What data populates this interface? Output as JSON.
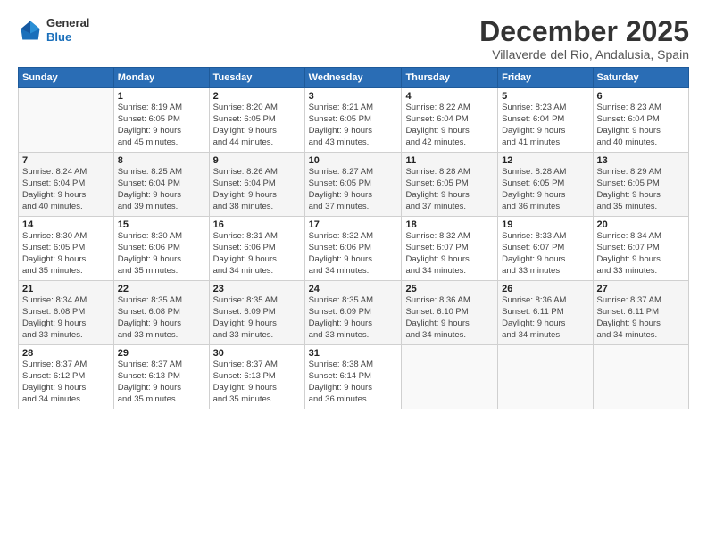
{
  "logo": {
    "general": "General",
    "blue": "Blue"
  },
  "title": "December 2025",
  "subtitle": "Villaverde del Rio, Andalusia, Spain",
  "weekdays": [
    "Sunday",
    "Monday",
    "Tuesday",
    "Wednesday",
    "Thursday",
    "Friday",
    "Saturday"
  ],
  "weeks": [
    [
      {
        "day": "",
        "info": ""
      },
      {
        "day": "1",
        "info": "Sunrise: 8:19 AM\nSunset: 6:05 PM\nDaylight: 9 hours\nand 45 minutes."
      },
      {
        "day": "2",
        "info": "Sunrise: 8:20 AM\nSunset: 6:05 PM\nDaylight: 9 hours\nand 44 minutes."
      },
      {
        "day": "3",
        "info": "Sunrise: 8:21 AM\nSunset: 6:05 PM\nDaylight: 9 hours\nand 43 minutes."
      },
      {
        "day": "4",
        "info": "Sunrise: 8:22 AM\nSunset: 6:04 PM\nDaylight: 9 hours\nand 42 minutes."
      },
      {
        "day": "5",
        "info": "Sunrise: 8:23 AM\nSunset: 6:04 PM\nDaylight: 9 hours\nand 41 minutes."
      },
      {
        "day": "6",
        "info": "Sunrise: 8:23 AM\nSunset: 6:04 PM\nDaylight: 9 hours\nand 40 minutes."
      }
    ],
    [
      {
        "day": "7",
        "info": "Sunrise: 8:24 AM\nSunset: 6:04 PM\nDaylight: 9 hours\nand 40 minutes."
      },
      {
        "day": "8",
        "info": "Sunrise: 8:25 AM\nSunset: 6:04 PM\nDaylight: 9 hours\nand 39 minutes."
      },
      {
        "day": "9",
        "info": "Sunrise: 8:26 AM\nSunset: 6:04 PM\nDaylight: 9 hours\nand 38 minutes."
      },
      {
        "day": "10",
        "info": "Sunrise: 8:27 AM\nSunset: 6:05 PM\nDaylight: 9 hours\nand 37 minutes."
      },
      {
        "day": "11",
        "info": "Sunrise: 8:28 AM\nSunset: 6:05 PM\nDaylight: 9 hours\nand 37 minutes."
      },
      {
        "day": "12",
        "info": "Sunrise: 8:28 AM\nSunset: 6:05 PM\nDaylight: 9 hours\nand 36 minutes."
      },
      {
        "day": "13",
        "info": "Sunrise: 8:29 AM\nSunset: 6:05 PM\nDaylight: 9 hours\nand 35 minutes."
      }
    ],
    [
      {
        "day": "14",
        "info": "Sunrise: 8:30 AM\nSunset: 6:05 PM\nDaylight: 9 hours\nand 35 minutes."
      },
      {
        "day": "15",
        "info": "Sunrise: 8:30 AM\nSunset: 6:06 PM\nDaylight: 9 hours\nand 35 minutes."
      },
      {
        "day": "16",
        "info": "Sunrise: 8:31 AM\nSunset: 6:06 PM\nDaylight: 9 hours\nand 34 minutes."
      },
      {
        "day": "17",
        "info": "Sunrise: 8:32 AM\nSunset: 6:06 PM\nDaylight: 9 hours\nand 34 minutes."
      },
      {
        "day": "18",
        "info": "Sunrise: 8:32 AM\nSunset: 6:07 PM\nDaylight: 9 hours\nand 34 minutes."
      },
      {
        "day": "19",
        "info": "Sunrise: 8:33 AM\nSunset: 6:07 PM\nDaylight: 9 hours\nand 33 minutes."
      },
      {
        "day": "20",
        "info": "Sunrise: 8:34 AM\nSunset: 6:07 PM\nDaylight: 9 hours\nand 33 minutes."
      }
    ],
    [
      {
        "day": "21",
        "info": "Sunrise: 8:34 AM\nSunset: 6:08 PM\nDaylight: 9 hours\nand 33 minutes."
      },
      {
        "day": "22",
        "info": "Sunrise: 8:35 AM\nSunset: 6:08 PM\nDaylight: 9 hours\nand 33 minutes."
      },
      {
        "day": "23",
        "info": "Sunrise: 8:35 AM\nSunset: 6:09 PM\nDaylight: 9 hours\nand 33 minutes."
      },
      {
        "day": "24",
        "info": "Sunrise: 8:35 AM\nSunset: 6:09 PM\nDaylight: 9 hours\nand 33 minutes."
      },
      {
        "day": "25",
        "info": "Sunrise: 8:36 AM\nSunset: 6:10 PM\nDaylight: 9 hours\nand 34 minutes."
      },
      {
        "day": "26",
        "info": "Sunrise: 8:36 AM\nSunset: 6:11 PM\nDaylight: 9 hours\nand 34 minutes."
      },
      {
        "day": "27",
        "info": "Sunrise: 8:37 AM\nSunset: 6:11 PM\nDaylight: 9 hours\nand 34 minutes."
      }
    ],
    [
      {
        "day": "28",
        "info": "Sunrise: 8:37 AM\nSunset: 6:12 PM\nDaylight: 9 hours\nand 34 minutes."
      },
      {
        "day": "29",
        "info": "Sunrise: 8:37 AM\nSunset: 6:13 PM\nDaylight: 9 hours\nand 35 minutes."
      },
      {
        "day": "30",
        "info": "Sunrise: 8:37 AM\nSunset: 6:13 PM\nDaylight: 9 hours\nand 35 minutes."
      },
      {
        "day": "31",
        "info": "Sunrise: 8:38 AM\nSunset: 6:14 PM\nDaylight: 9 hours\nand 36 minutes."
      },
      {
        "day": "",
        "info": ""
      },
      {
        "day": "",
        "info": ""
      },
      {
        "day": "",
        "info": ""
      }
    ]
  ]
}
